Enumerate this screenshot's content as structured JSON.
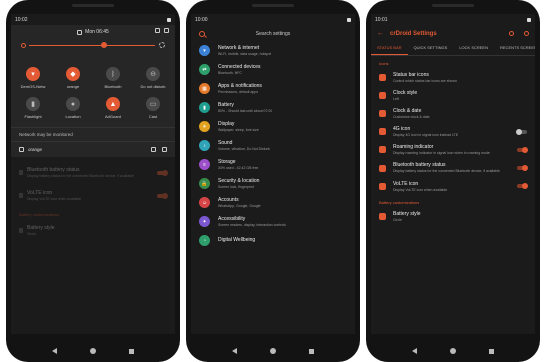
{
  "accent": "#e35a34",
  "phone1": {
    "time": "10:02",
    "date": "Mon 06:45",
    "tiles": [
      {
        "label": "DemOS-Netw",
        "on": true,
        "glyph": "▾"
      },
      {
        "label": "orange",
        "on": true,
        "glyph": "◆"
      },
      {
        "label": "Bluetooth",
        "on": false,
        "glyph": "ᛒ"
      },
      {
        "label": "Do not disturb",
        "on": false,
        "glyph": "⊖"
      },
      {
        "label": "Flashlight",
        "on": false,
        "glyph": "▮"
      },
      {
        "label": "Location",
        "on": false,
        "glyph": "●"
      },
      {
        "label": "AdGuard",
        "on": true,
        "glyph": "▲"
      },
      {
        "label": "Cast",
        "on": false,
        "glyph": "▭"
      }
    ],
    "network_text": "Network may be monitored",
    "user_name": "orange",
    "dim_items": [
      {
        "title": "Bluetooth battery status",
        "sub": "Display battery status for the connected Bluetooth device, if available"
      },
      {
        "title": "VoLTE icon",
        "sub": "Display VoLTE icon when available"
      }
    ],
    "dim_section": "Battery customizations",
    "dim_last": {
      "title": "Battery style",
      "sub": "Circle"
    }
  },
  "phone2": {
    "time": "10:00",
    "search_placeholder": "Search settings",
    "items": [
      {
        "title": "Network & internet",
        "sub": "Wi-Fi, mobile, data usage, hotspot",
        "color": "#3b82d6",
        "glyph": "▾"
      },
      {
        "title": "Connected devices",
        "sub": "Bluetooth, NFC",
        "color": "#2e9e6b",
        "glyph": "⇄"
      },
      {
        "title": "Apps & notifications",
        "sub": "Permissions, default apps",
        "color": "#e57a2a",
        "glyph": "▦"
      },
      {
        "title": "Battery",
        "sub": "80% - Should last until about 07:00",
        "color": "#1f9d8f",
        "glyph": "▮"
      },
      {
        "title": "Display",
        "sub": "Wallpaper, sleep, font size",
        "color": "#e0a21f",
        "glyph": "☀"
      },
      {
        "title": "Sound",
        "sub": "Volume, vibration, Do Not Disturb",
        "color": "#2fa3b8",
        "glyph": "♪"
      },
      {
        "title": "Storage",
        "sub": "34% used - 42.42 GB free",
        "color": "#9c4fc9",
        "glyph": "≡"
      },
      {
        "title": "Security & location",
        "sub": "Screen lock, fingerprint",
        "color": "#3a8c4a",
        "glyph": "🔒"
      },
      {
        "title": "Accounts",
        "sub": "WhatsApp, Google, Google",
        "color": "#d64545",
        "glyph": "☺"
      },
      {
        "title": "Accessibility",
        "sub": "Screen readers, display, interaction controls",
        "color": "#7b57d1",
        "glyph": "✦"
      },
      {
        "title": "Digital Wellbeing",
        "sub": "",
        "color": "#2e9e6b",
        "glyph": "◔"
      }
    ]
  },
  "phone3": {
    "time": "10:01",
    "title": "crDroid Settings",
    "tabs": [
      "STATUS BAR",
      "QUICK SETTINGS",
      "LOCK SCREEN",
      "RECENTS SCREEN"
    ],
    "section_icons": "Icons",
    "items": [
      {
        "title": "Status bar icons",
        "sub": "Control which status bar icons are shown",
        "toggle": null
      },
      {
        "title": "Clock style",
        "sub": "Left",
        "toggle": null
      },
      {
        "title": "Clock & date",
        "sub": "Customize clock & date",
        "toggle": null
      },
      {
        "title": "4G icon",
        "sub": "Display 4G icon in signal icon instead LTE",
        "toggle": "off"
      },
      {
        "title": "Roaming indicator",
        "sub": "Display roaming indicator in signal icon when in roaming mode",
        "toggle": "on"
      },
      {
        "title": "Bluetooth battery status",
        "sub": "Display battery status for the connected Bluetooth device, if available",
        "toggle": "on"
      },
      {
        "title": "VoLTE icon",
        "sub": "Display VoLTE icon when available",
        "toggle": "on"
      }
    ],
    "section_battery": "Battery customizations",
    "battery_item": {
      "title": "Battery style",
      "sub": "Circle"
    }
  }
}
